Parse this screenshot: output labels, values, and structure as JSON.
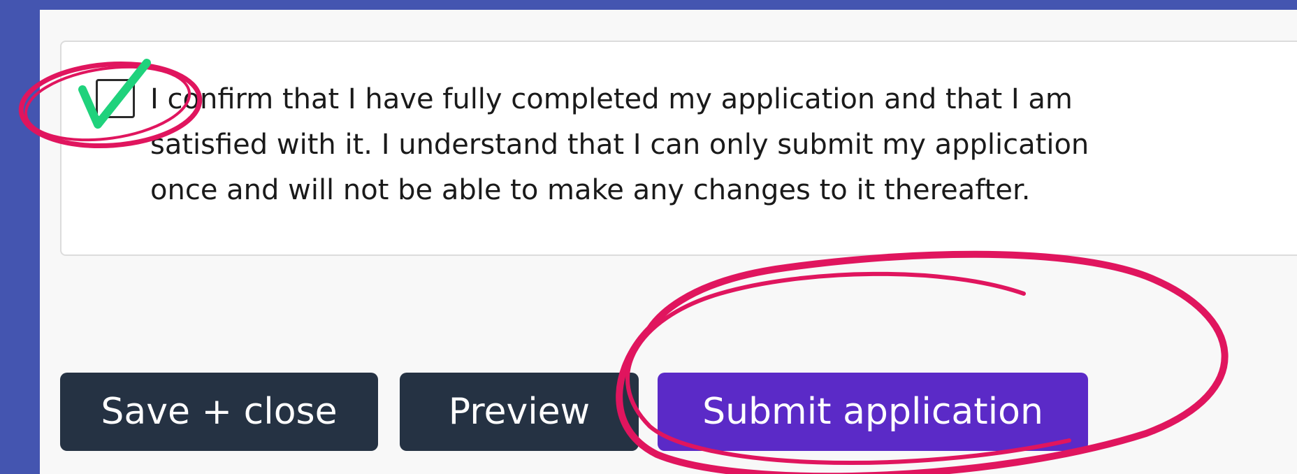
{
  "confirmation": {
    "checkbox_checked": true,
    "text": "I confirm that I have fully completed my application and that I am satisfied with it. I understand that I can only submit my application once and will not be able to make any changes to it thereafter."
  },
  "buttons": {
    "save_close": "Save + close",
    "preview": "Preview",
    "submit": "Submit application"
  },
  "colors": {
    "background": "#4455b0",
    "panel": "#f8f8f8",
    "dark_button": "#253243",
    "submit_button": "#5b2ac7",
    "annotation_circle": "#e0155e",
    "annotation_check": "#1fd27c"
  },
  "annotations": {
    "checkmark_icon": "check-icon",
    "circle_icon": "hand-drawn-circle-icon"
  }
}
